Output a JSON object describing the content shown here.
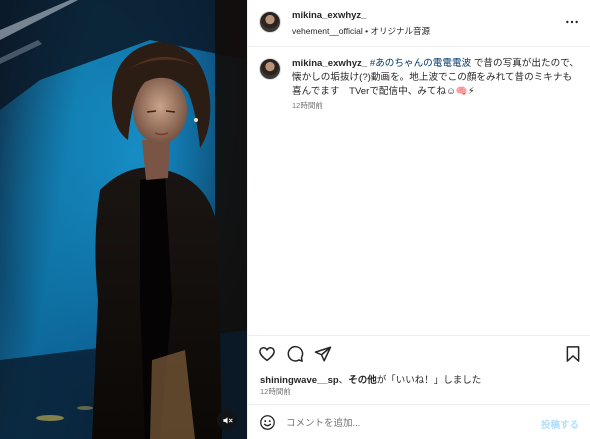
{
  "header": {
    "username": "mikina_exwhyz_",
    "audio_owner": "vehement__official",
    "separator": " • ",
    "audio_label": "オリジナル音源"
  },
  "caption": {
    "username": "mikina_exwhyz_",
    "hashtag": "#あのちゃんの電電電波",
    "text": " で昔の写真が出たので、懐かしの垢抜け(?)動画を。地上波でこの顔をみれて昔のミキナも喜んでます　TVerで配信中、みてね☺🧠⚡",
    "time": "12時間前"
  },
  "likes": {
    "user": "shiningwave__sp",
    "joiner": "、",
    "others": "その他",
    "suffix": "が「いいね！」しました"
  },
  "post_time": "12時間前",
  "comment": {
    "placeholder": "コメントを追加...",
    "post_label": "投稿する"
  },
  "icons": {
    "more": "more-dots-icon",
    "like": "heart-icon",
    "comment": "comment-bubble-icon",
    "share": "paper-plane-icon",
    "save": "bookmark-icon",
    "emoji": "smiley-icon",
    "mute": "speaker-muted-icon"
  },
  "colors": {
    "hashtag": "#00376b",
    "post_button_disabled": "#b2dffc",
    "secondary_text": "#737373",
    "divider": "#efefef"
  }
}
